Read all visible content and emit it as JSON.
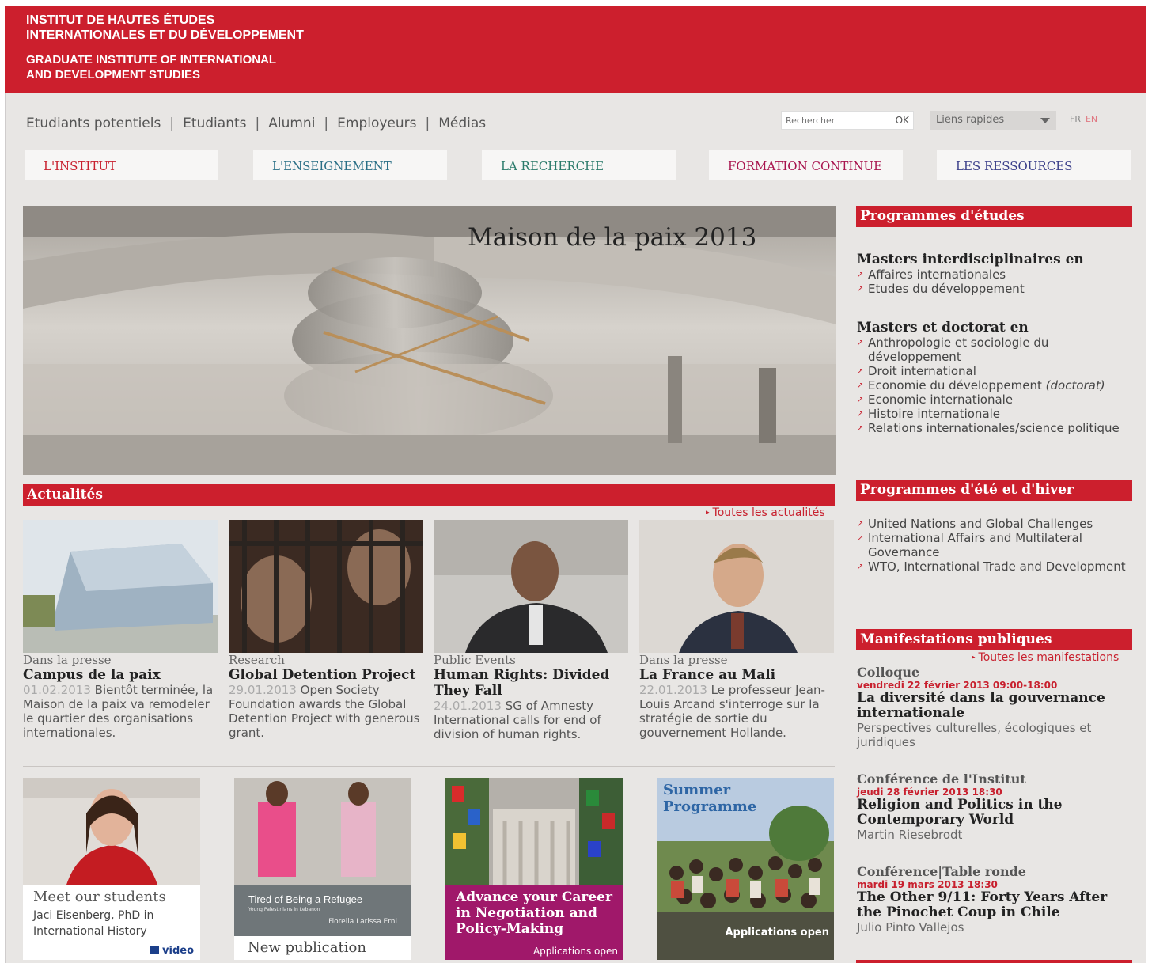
{
  "header": {
    "line1": "INSTITUT DE HAUTES ÉTUDES",
    "line2": "INTERNATIONALES ET DU DÉVELOPPEMENT",
    "line3": "GRADUATE INSTITUTE OF INTERNATIONAL",
    "line4": "AND DEVELOPMENT STUDIES"
  },
  "topnav": [
    "Etudiants potentiels",
    "Etudiants",
    "Alumni",
    "Employeurs",
    "Médias"
  ],
  "search": {
    "placeholder": "Rechercher",
    "ok": "OK"
  },
  "quicklinks": "Liens rapides",
  "lang": {
    "fr": "FR",
    "en": "EN"
  },
  "mainnav": [
    "L'INSTITUT",
    "L'ENSEIGNEMENT",
    "LA RECHERCHE",
    "FORMATION CONTINUE",
    "LES RESSOURCES"
  ],
  "hero": {
    "caption": "Maison de la paix 2013"
  },
  "news": {
    "heading": "Actualités",
    "all_link": "Toutes les actualités",
    "items": [
      {
        "category": "Dans la presse",
        "title": "Campus de la paix",
        "date": "01.02.2013",
        "text": "Bientôt terminée, la Maison de la paix va remodeler le quartier des organisations internationales."
      },
      {
        "category": "Research",
        "title": "Global Detention Project",
        "date": "29.01.2013",
        "text": "Open Society Foundation awards the Global Detention Project with generous grant."
      },
      {
        "category": "Public Events",
        "title": "Human Rights: Divided They Fall",
        "date": "24.01.2013",
        "text": "SG of Amnesty International calls for end of division of human rights."
      },
      {
        "category": "Dans la presse",
        "title": "La France au Mali",
        "date": "22.01.2013",
        "text": "Le professeur Jean-Louis Arcand s'interroge sur la stratégie de sortie du gouvernement Hollande."
      }
    ]
  },
  "promos": [
    {
      "title": "Meet our students",
      "line1": "Jaci Eisenberg, PhD in",
      "line2": "International History",
      "video": "video"
    },
    {
      "book_title": "Tired of Being a Refugee",
      "book_sub": "Young Palestinians in Lebanon",
      "book_author": "Fiorella Larissa Erni",
      "label": "New publication"
    },
    {
      "line1": "Advance your Career",
      "line2": "in Negotiation and",
      "line3": "Policy-Making",
      "apps": "Applications open"
    },
    {
      "line1": "Summer",
      "line2": "Programme",
      "apps": "Applications open"
    }
  ],
  "sidebar": {
    "programmes_heading": "Programmes d'études",
    "group1_title": "Masters interdisciplinaires en",
    "group1_links": [
      "Affaires internationales",
      "Etudes du développement"
    ],
    "group2_title": "Masters et doctorat en",
    "group2_links": [
      "Anthropologie et sociologie du développement",
      "Droit international",
      "Economie du développement",
      "Economie internationale",
      "Histoire internationale",
      "Relations internationales/science politique"
    ],
    "doctorat_note": "(doctorat)",
    "summer_heading": "Programmes d'été et d'hiver",
    "summer_links": [
      "United Nations and Global Challenges",
      "International Affairs and Multilateral Governance",
      "WTO, International Trade and Development"
    ],
    "events_heading": "Manifestations publiques",
    "events_all": "Toutes les manifestations",
    "events": [
      {
        "type": "Colloque",
        "date": "vendredi 22 février 2013 09:00-18:00",
        "title": "La diversité dans la gouvernance internationale",
        "sub": "Perspectives culturelles, écologiques et juridiques"
      },
      {
        "type": "Conférence de l'Institut",
        "date": "jeudi 28 février 2013 18:30",
        "title": "Religion and Politics in the Contemporary World",
        "sub": "Martin Riesebrodt"
      },
      {
        "type": "Conférence|Table ronde",
        "date": "mardi 19 mars 2013 18:30",
        "title": "The Other 9/11: Forty Years After the Pinochet Coup in Chile",
        "sub": "Julio Pinto Vallejos"
      }
    ]
  },
  "colors": {
    "brand_red": "#cc1f2d",
    "page_bg": "#e8e6e4"
  }
}
